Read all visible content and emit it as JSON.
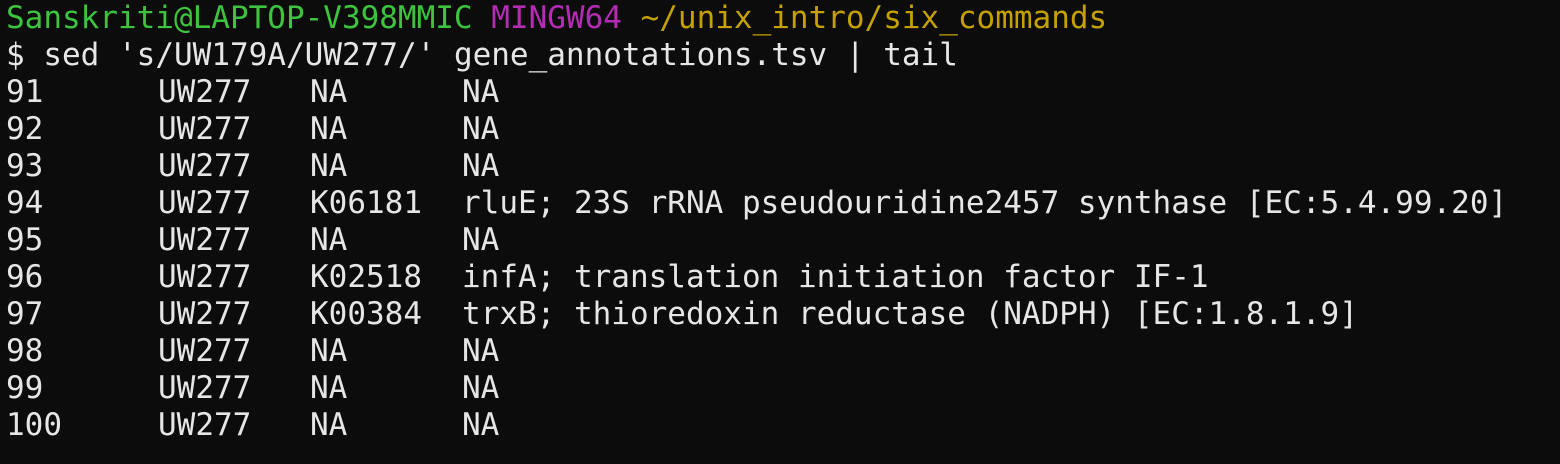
{
  "prompt": {
    "user_host": "Sanskriti@LAPTOP-V398MMIC",
    "system": "MINGW64",
    "cwd": "~/unix_intro/six_commands"
  },
  "command": {
    "symbol": "$",
    "text": "sed 's/UW179A/UW277/' gene_annotations.tsv | tail"
  },
  "output": [
    {
      "id": "91",
      "genome": "UW277",
      "ko": "NA",
      "description": "NA"
    },
    {
      "id": "92",
      "genome": "UW277",
      "ko": "NA",
      "description": "NA"
    },
    {
      "id": "93",
      "genome": "UW277",
      "ko": "NA",
      "description": "NA"
    },
    {
      "id": "94",
      "genome": "UW277",
      "ko": "K06181",
      "description": "rluE; 23S rRNA pseudouridine2457 synthase [EC:5.4.99.20]"
    },
    {
      "id": "95",
      "genome": "UW277",
      "ko": "NA",
      "description": "NA"
    },
    {
      "id": "96",
      "genome": "UW277",
      "ko": "K02518",
      "description": "infA; translation initiation factor IF-1"
    },
    {
      "id": "97",
      "genome": "UW277",
      "ko": "K00384",
      "description": "trxB; thioredoxin reductase (NADPH) [EC:1.8.1.9]"
    },
    {
      "id": "98",
      "genome": "UW277",
      "ko": "NA",
      "description": "NA"
    },
    {
      "id": "99",
      "genome": "UW277",
      "ko": "NA",
      "description": "NA"
    },
    {
      "id": "100",
      "genome": "UW277",
      "ko": "NA",
      "description": "NA"
    }
  ],
  "colors": {
    "background": "#0c0c0c",
    "text": "#e6e6e6",
    "user_host": "#3ec33e",
    "system": "#b42cb4",
    "path": "#c4a000"
  }
}
